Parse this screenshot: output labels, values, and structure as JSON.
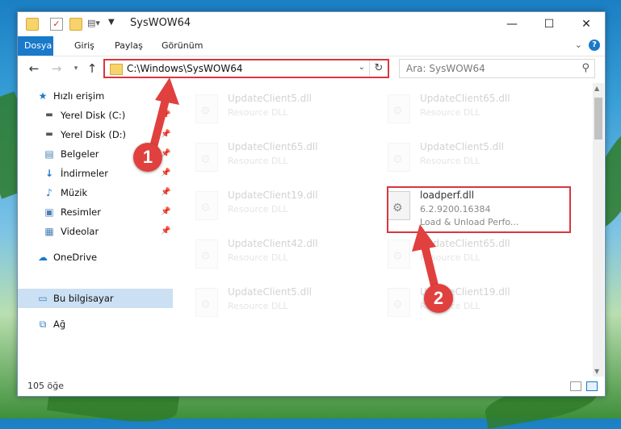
{
  "window": {
    "title": "SysWOW64",
    "controls": {
      "minimize": "—",
      "maximize": "☐",
      "close": "✕"
    }
  },
  "ribbon": {
    "tabs": [
      {
        "label": "Dosya",
        "active": true
      },
      {
        "label": "Giriş"
      },
      {
        "label": "Paylaş"
      },
      {
        "label": "Görünüm"
      }
    ],
    "help": "?"
  },
  "address_bar": {
    "path": "C:\\Windows\\SysWOW64",
    "search_placeholder": "Ara: SysWOW64"
  },
  "sidebar": {
    "items": [
      {
        "label": "Hızlı erişim",
        "icon": "star-icon"
      },
      {
        "label": "Yerel Disk (C:)",
        "icon": "drive-icon",
        "pinned": true
      },
      {
        "label": "Yerel Disk (D:)",
        "icon": "drive-icon",
        "pinned": true
      },
      {
        "label": "Belgeler",
        "icon": "document-icon",
        "pinned": true
      },
      {
        "label": "İndirmeler",
        "icon": "download-icon",
        "pinned": true
      },
      {
        "label": "Müzik",
        "icon": "music-icon",
        "pinned": true
      },
      {
        "label": "Resimler",
        "icon": "pictures-icon",
        "pinned": true
      },
      {
        "label": "Videolar",
        "icon": "video-icon",
        "pinned": true
      },
      {
        "label": "OneDrive",
        "icon": "cloud-icon"
      },
      {
        "label": "Bu bilgisayar",
        "icon": "computer-icon",
        "selected": true
      },
      {
        "label": "Ağ",
        "icon": "network-icon"
      }
    ]
  },
  "files": [
    {
      "name": "UpdateClient5.dll",
      "desc": "Resource DLL",
      "faded": true
    },
    {
      "name": "UpdateClient65.dll",
      "desc": "Resource DLL",
      "faded": true
    },
    {
      "name": "UpdateClient65.dll",
      "desc": "Resource DLL",
      "faded": true
    },
    {
      "name": "UpdateClient5.dll",
      "desc": "Resource DLL",
      "faded": true
    },
    {
      "name": "UpdateClient19.dll",
      "desc": "Resource DLL",
      "faded": true
    },
    {
      "name": "loadperf.dll",
      "version": "6.2.9200.16384",
      "desc": "Load & Unload Perfo...",
      "faded": false
    },
    {
      "name": "UpdateClient42.dll",
      "desc": "Resource DLL",
      "faded": true
    },
    {
      "name": "UpdateClient65.dll",
      "desc": "Resource DLL",
      "faded": true
    },
    {
      "name": "UpdateClient5.dll",
      "desc": "Resource DLL",
      "faded": true
    },
    {
      "name": "UpdateClient19.dll",
      "desc": "Resource DLL",
      "faded": true
    }
  ],
  "status": {
    "item_count": "105 öğe"
  },
  "annotations": [
    {
      "label": "1"
    },
    {
      "label": "2"
    }
  ],
  "colors": {
    "accent": "#1979ca",
    "highlight": "#d9363e",
    "selected": "#cce0f4"
  }
}
